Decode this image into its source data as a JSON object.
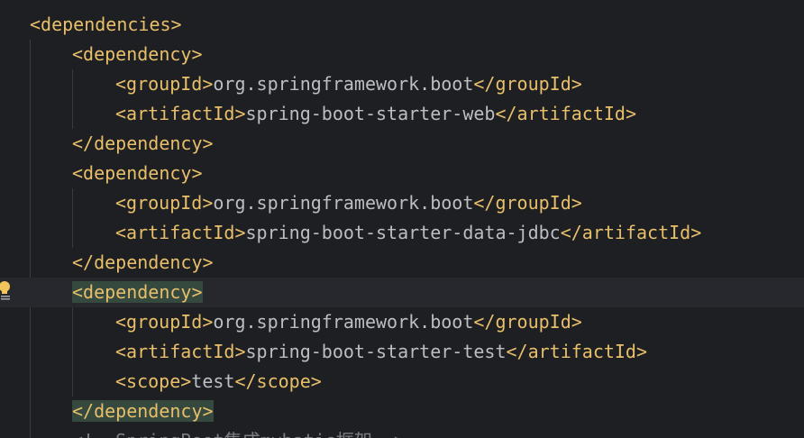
{
  "editor": {
    "lines": [
      {
        "indent": 0,
        "parts": [
          {
            "t": "tag",
            "v": "<dependencies>"
          }
        ]
      },
      {
        "indent": 1,
        "parts": [
          {
            "t": "tag",
            "v": "<dependency>"
          }
        ]
      },
      {
        "indent": 2,
        "parts": [
          {
            "t": "tag",
            "v": "<groupId>"
          },
          {
            "t": "txt",
            "v": "org.springframework.boot"
          },
          {
            "t": "tag",
            "v": "</groupId>"
          }
        ]
      },
      {
        "indent": 2,
        "parts": [
          {
            "t": "tag",
            "v": "<artifactId>"
          },
          {
            "t": "txt",
            "v": "spring-boot-starter-web"
          },
          {
            "t": "tag",
            "v": "</artifactId>"
          }
        ]
      },
      {
        "indent": 1,
        "parts": [
          {
            "t": "tag",
            "v": "</dependency>"
          }
        ]
      },
      {
        "indent": 1,
        "parts": [
          {
            "t": "tag",
            "v": "<dependency>"
          }
        ]
      },
      {
        "indent": 2,
        "parts": [
          {
            "t": "tag",
            "v": "<groupId>"
          },
          {
            "t": "txt",
            "v": "org.springframework.boot"
          },
          {
            "t": "tag",
            "v": "</groupId>"
          }
        ]
      },
      {
        "indent": 2,
        "parts": [
          {
            "t": "tag",
            "v": "<artifactId>"
          },
          {
            "t": "txt",
            "v": "spring-boot-starter-data-jdbc"
          },
          {
            "t": "tag",
            "v": "</artifactId>"
          }
        ]
      },
      {
        "indent": 1,
        "parts": [
          {
            "t": "tag",
            "v": "</dependency>"
          }
        ]
      },
      {
        "indent": 1,
        "current": true,
        "parts": [
          {
            "t": "tag",
            "v": "<dependency>",
            "hl": true
          }
        ]
      },
      {
        "indent": 2,
        "parts": [
          {
            "t": "tag",
            "v": "<groupId>"
          },
          {
            "t": "txt",
            "v": "org.springframework.boot"
          },
          {
            "t": "tag",
            "v": "</groupId>"
          }
        ]
      },
      {
        "indent": 2,
        "parts": [
          {
            "t": "tag",
            "v": "<artifactId>"
          },
          {
            "t": "txt",
            "v": "spring-boot-starter-test"
          },
          {
            "t": "tag",
            "v": "</artifactId>"
          }
        ]
      },
      {
        "indent": 2,
        "parts": [
          {
            "t": "tag",
            "v": "<scope>"
          },
          {
            "t": "txt",
            "v": "test"
          },
          {
            "t": "tag",
            "v": "</scope>"
          }
        ]
      },
      {
        "indent": 1,
        "parts": [
          {
            "t": "tag",
            "v": "</dependency>",
            "hl": true
          }
        ]
      },
      {
        "indent": 1,
        "parts": [
          {
            "t": "cmt",
            "v": "<!--SpringBoot集成mybatis框架-->"
          }
        ]
      }
    ]
  },
  "gutter": {
    "intention_icon": "lightbulb-icon",
    "bulb_color": "#f2c55c"
  },
  "colors": {
    "background": "#1e1f22",
    "tag": "#e8bf6a",
    "text": "#bcbec4",
    "comment": "#7a7e85",
    "brace_highlight": "#35493f",
    "current_line": "#26282e"
  }
}
